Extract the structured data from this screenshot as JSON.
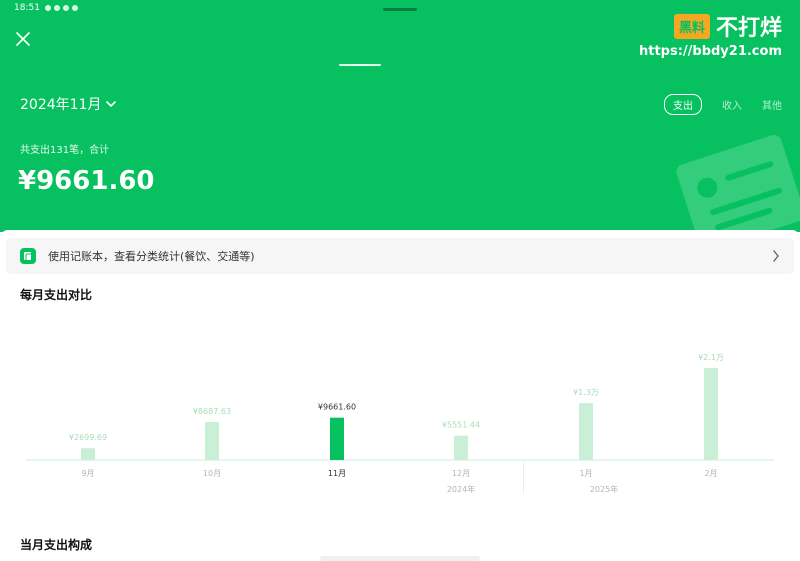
{
  "status": {
    "time": "18:51"
  },
  "header": {
    "month": "2024年11月",
    "tabs": [
      {
        "label": "支出",
        "active": true
      },
      {
        "label": "收入",
        "active": false
      },
      {
        "label": "其他",
        "active": false
      }
    ],
    "count_text": "共支出131笔，合计",
    "total": "¥9661.60"
  },
  "watermark": {
    "logo": "黑料",
    "name": "不打烊",
    "url": "https://bbdy21.com"
  },
  "promo": {
    "text": "使用记账本，查看分类统计(餐饮、交通等)"
  },
  "sections": {
    "monthly_compare_title": "每月支出对比",
    "composition_title": "当月支出构成"
  },
  "colors": {
    "brand": "#07c160",
    "bar_light": "#c9efd6",
    "label": "#a8dcb9",
    "bar_active": "#07c160"
  },
  "chart_data": {
    "type": "bar",
    "categories": [
      "9月",
      "10月",
      "11月",
      "12月",
      "1月",
      "2月"
    ],
    "values": [
      2699.69,
      8687.63,
      9661.6,
      5551.44,
      13000,
      21000
    ],
    "labels": [
      "¥2699.69",
      "¥8687.63",
      "¥9661.60",
      "¥5551.44",
      "¥1.3万",
      "¥2.1万"
    ],
    "highlight_index": 2,
    "year_labels": [
      "2024年",
      "2025年"
    ],
    "ylim": [
      0,
      21000
    ],
    "grid": false
  }
}
